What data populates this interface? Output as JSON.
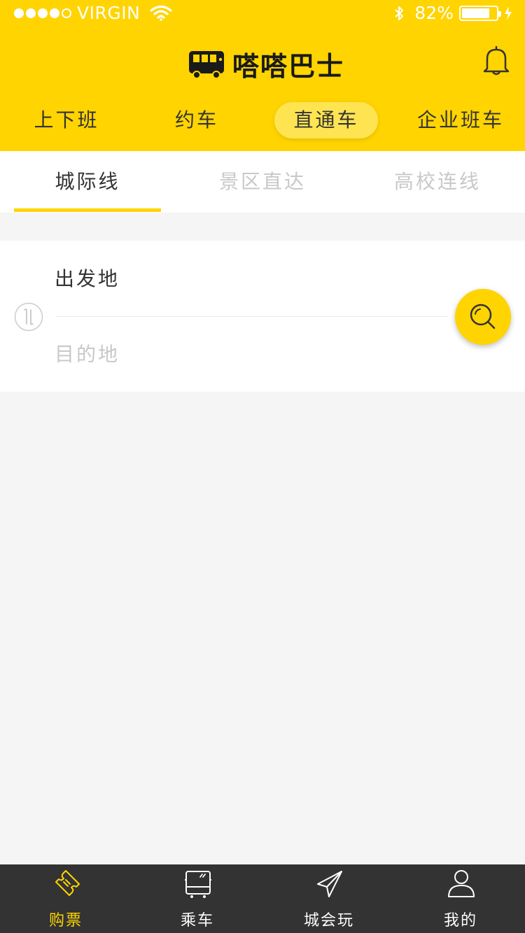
{
  "status_bar": {
    "carrier": "VIRGIN",
    "battery_percent": "82%",
    "battery_level": 0.82
  },
  "header": {
    "title": "嗒嗒巴士",
    "logo_icon": "bus-logo-icon",
    "notification_icon": "bell-icon"
  },
  "category_tabs": [
    {
      "label": "上下班",
      "active": false
    },
    {
      "label": "约车",
      "active": false
    },
    {
      "label": "直通车",
      "active": true
    },
    {
      "label": "企业班车",
      "active": false
    }
  ],
  "route_tabs": [
    {
      "label": "城际线",
      "active": true
    },
    {
      "label": "景区直达",
      "active": false
    },
    {
      "label": "高校连线",
      "active": false
    }
  ],
  "search": {
    "from_label": "出发地",
    "to_placeholder": "目的地",
    "swap_icon": "swap-arrows-icon",
    "search_icon": "search-icon"
  },
  "bottom_nav": [
    {
      "label": "购票",
      "icon": "ticket-icon",
      "active": true
    },
    {
      "label": "乘车",
      "icon": "bus-icon",
      "active": false
    },
    {
      "label": "城会玩",
      "icon": "paper-plane-icon",
      "active": false
    },
    {
      "label": "我的",
      "icon": "user-icon",
      "active": false
    }
  ],
  "colors": {
    "brand_yellow": "#ffd400",
    "active_tab_bg": "#ffe452",
    "nav_bg": "#333333",
    "text_dark": "#333333",
    "text_muted": "#c8c8c8",
    "page_bg": "#f5f5f5"
  }
}
